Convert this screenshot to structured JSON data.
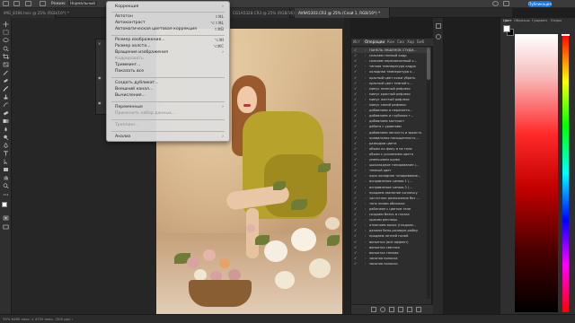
{
  "optionbar": {
    "mode_label": "Режим:",
    "mode_value": "Нормальный",
    "share_label": "Публикация"
  },
  "tabs": [
    "IMG_8194.heic @ 25% (RGB/16*) *",
    "CG1A5328.CR3 @ 25% (RGB/16) *",
    "AV9A5303.CR3 @ 25% (Слой 1, RGB/16*) *"
  ],
  "menu": {
    "items": [
      {
        "label": "Коррекция",
        "submenu": true
      },
      {
        "label": "Автотон",
        "shortcut": "⇧⌘L"
      },
      {
        "label": "Автоконтраст",
        "shortcut": "⌥⇧⌘L"
      },
      {
        "label": "Автоматическая цветовая коррекция",
        "shortcut": "⇧⌘B"
      },
      {
        "label": "Размер изображения...",
        "shortcut": "⌥⌘I"
      },
      {
        "label": "Размер холста...",
        "shortcut": "⌥⌘C"
      },
      {
        "label": "Вращение изображения",
        "submenu": true
      },
      {
        "label": "Кадрировать",
        "disabled": true
      },
      {
        "label": "Тримминг..."
      },
      {
        "label": "Показать все"
      },
      {
        "label": "Создать дубликат..."
      },
      {
        "label": "Внешний канал..."
      },
      {
        "label": "Вычисления..."
      },
      {
        "label": "Переменные",
        "submenu": true
      },
      {
        "label": "Применить набор данных...",
        "disabled": true
      },
      {
        "label": "Треппинг...",
        "disabled": true
      },
      {
        "label": "Анализ",
        "submenu": true
      }
    ]
  },
  "actions_panel": {
    "tabs": [
      "Ист",
      "Операции",
      "Кон",
      "Сво",
      "Хар",
      "Биб"
    ],
    "active_tab": "Операции",
    "check": "✓",
    "caret": "›",
    "rows": [
      "ПАНЕЛЬ ЭКШЕНОВ СТУДИ...",
      "спасаем темный кадр",
      "спасаем пересвеченный к...",
      "теплая температура кадра",
      "холодная температура к...",
      "красный цвет кожи убрать",
      "красный цвет темной к...",
      "минус зеленый рефлекс",
      "минус красный рефлекс",
      "минус желтый рефлекс",
      "минус синий рефлекс",
      "добавляем и пересвето...",
      "добавляем и глубокое т...",
      "добавляем контраст",
      "работа с уровнями",
      "добавляем легкость и яркость",
      "правильная насыщенность ...",
      "разводим цвета",
      "объем по фону и на теле",
      "объем с усилением цвета",
      "уменьшаем шумы",
      "шоколадное тонирование (...",
      "темный цвет",
      "охро холодное тонирование...",
      "исправление синюю 1 (...",
      "исправление синюю 2 (...",
      "продаем свечение соплочку",
      "частотное разложение без ...",
      "тонк линии обложки",
      "работаем с цветом теле",
      "создаем блеск в глазах",
      "красим ресницы",
      "отменяем волос (гладкие...",
      "делаем бело-розовую рыбку",
      "продаем летней ночей",
      "виньетка (всё эффект)",
      "виньетка светлая",
      "виньетка темная",
      "засоняя полоска",
      "засоняя полоски"
    ]
  },
  "color_panel": {
    "tabs": [
      "Цвет",
      "Образцы",
      "Градиен",
      "Узоры"
    ],
    "foreground": "#ffffff",
    "background": "#000000",
    "hue_fraction": 0.0
  },
  "status": {
    "text": "39%    6480 пикс. x 4720 пикс. (300 ppi)    ›"
  },
  "colors": {
    "accent": "#1473e6",
    "panel_bg": "#2d2d2d",
    "menu_bg": "#dedede"
  }
}
